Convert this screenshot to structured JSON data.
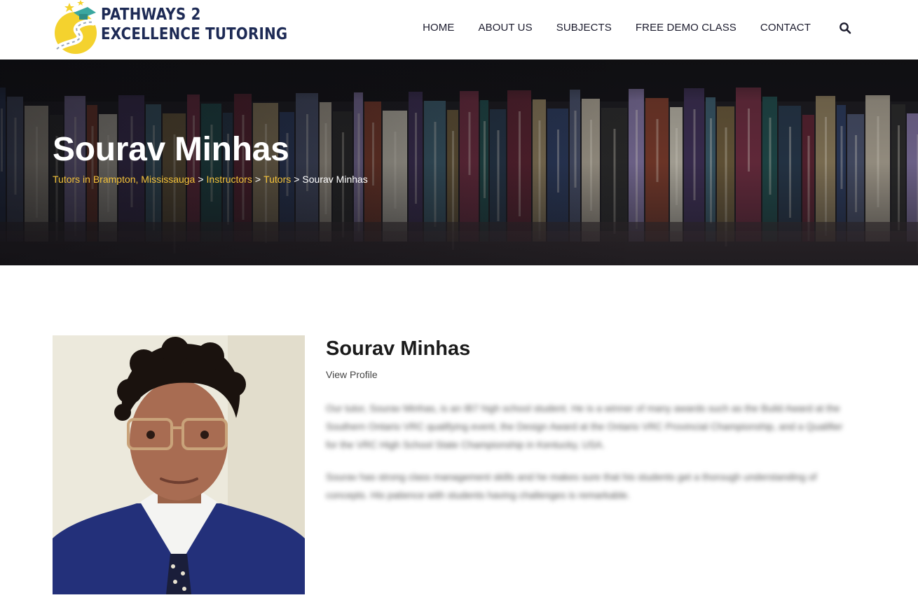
{
  "header": {
    "logo": {
      "line1": "PATHWAYS 2",
      "line2": "EXCELLENCE TUTORING"
    },
    "nav": [
      "HOME",
      "ABOUT US",
      "SUBJECTS",
      "FREE DEMO CLASS",
      "CONTACT"
    ],
    "search_icon": "search-icon"
  },
  "hero": {
    "title": "Sourav Minhas",
    "breadcrumb": {
      "crumbs": [
        "Tutors in Brampton, Mississauga",
        "Instructors",
        "Tutors"
      ],
      "separator": ">",
      "current": "Sourav Minhas"
    }
  },
  "profile": {
    "name": "Sourav Minhas",
    "view_profile": "View Profile",
    "bio": [
      "Our tutor, Sourav Minhas, is an IB7 high school student. He is a winner of many awards such as the Build Award at the Southern Ontario VRC qualifying event, the Design Award at the Ontario VRC Provincial Championship, and a Qualifier for the VRC High School State Championship in Kentucky, USA.",
      "Sourav has strong class management skills and he makes sure that his students get a thorough understanding of concepts. His patience with students having challenges is remarkable."
    ]
  },
  "colors": {
    "brand_navy": "#1d2a55",
    "accent_yellow": "#f3c23a",
    "hero_dark": "#1a1a1e"
  }
}
